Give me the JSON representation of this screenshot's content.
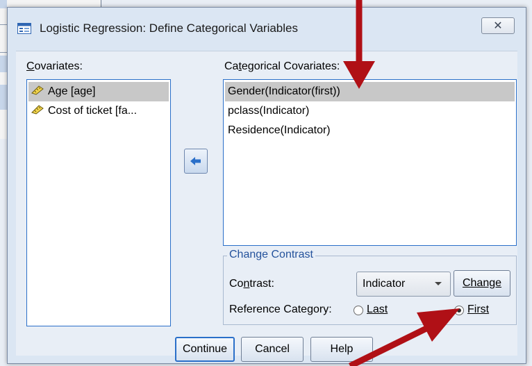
{
  "dialog": {
    "title": "Logistic Regression: Define Categorical Variables",
    "close_symbol": "✕"
  },
  "covariates": {
    "label_first": "C",
    "label_rest": "ovariates:",
    "items": [
      {
        "label": "Age [age]",
        "selected": true
      },
      {
        "label": "Cost of ticket [fa...",
        "selected": false
      }
    ]
  },
  "categorical": {
    "label_pre": "Ca",
    "label_u": "t",
    "label_post": "egorical Covariates:",
    "items": [
      {
        "label": "Gender(Indicator(first))",
        "selected": true
      },
      {
        "label": "pclass(Indicator)",
        "selected": false
      },
      {
        "label": "Residence(Indicator)",
        "selected": false
      }
    ]
  },
  "change_contrast": {
    "group_title": "Change Contrast",
    "contrast_label_pre": "Co",
    "contrast_label_u": "n",
    "contrast_label_post": "trast:",
    "contrast_value": "Indicator",
    "change_button": "Change",
    "reference_label": "Reference Category:",
    "last_label": "Last",
    "first_label": "First",
    "selected_reference": "First"
  },
  "buttons": {
    "continue": "Continue",
    "cancel": "Cancel",
    "help": "Help"
  },
  "colors": {
    "dialog_bg": "#dbe6f3",
    "accent_blue": "#2a6fc9",
    "annotation_red": "#b01016",
    "selection_gray": "#c8c8c8"
  },
  "icons": {
    "title": "spss-dialog-icon",
    "variable": "ruler-scale-icon",
    "move": "left-arrow-icon"
  }
}
